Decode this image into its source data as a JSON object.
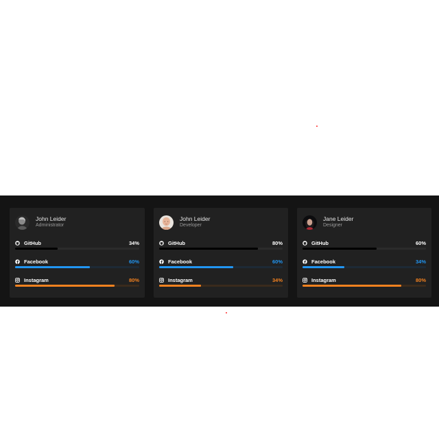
{
  "colors": {
    "page_background": "#ffffff",
    "band_background": "#141414",
    "card_background": "#212121",
    "github": "#000000",
    "github_track": "#2b2b2b",
    "facebook": "#2196f3",
    "facebook_track": "#1d2a36",
    "instagram": "#f5821f",
    "instagram_track": "#3a2a1c",
    "github_value_text": "#ffffff"
  },
  "cards": [
    {
      "name": "John Leider",
      "role": "Administrator",
      "avatar_icon": "avatar-grayscale-portrait",
      "stats": [
        {
          "label": "GitHub",
          "value": "34%",
          "level": 0.34,
          "icon": "github-icon"
        },
        {
          "label": "Facebook",
          "value": "60%",
          "level": 0.6,
          "icon": "facebook-icon"
        },
        {
          "label": "Instagram",
          "value": "80%",
          "level": 0.8,
          "icon": "instagram-icon"
        }
      ]
    },
    {
      "name": "John Leider",
      "role": "Developer",
      "avatar_icon": "avatar-bald-portrait",
      "stats": [
        {
          "label": "GitHub",
          "value": "80%",
          "level": 0.8,
          "icon": "github-icon"
        },
        {
          "label": "Facebook",
          "value": "60%",
          "level": 0.6,
          "icon": "facebook-icon"
        },
        {
          "label": "Instagram",
          "value": "34%",
          "level": 0.34,
          "icon": "instagram-icon"
        }
      ]
    },
    {
      "name": "Jane Leider",
      "role": "Designer",
      "avatar_icon": "avatar-dark-portrait",
      "stats": [
        {
          "label": "GitHub",
          "value": "60%",
          "level": 0.6,
          "icon": "github-icon"
        },
        {
          "label": "Facebook",
          "value": "34%",
          "level": 0.34,
          "icon": "facebook-icon"
        },
        {
          "label": "Instagram",
          "value": "80%",
          "level": 0.8,
          "icon": "instagram-icon"
        }
      ]
    }
  ]
}
